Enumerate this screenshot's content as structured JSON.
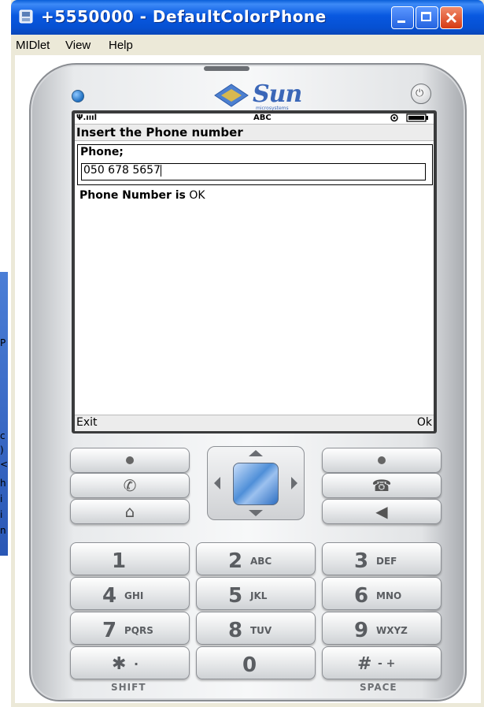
{
  "window": {
    "title": "+5550000 - DefaultColorPhone",
    "colors": {
      "titlebar": "#0858e0",
      "close": "#d63a13"
    }
  },
  "menu": [
    "MIDlet",
    "View",
    "Help"
  ],
  "background_fragments": [
    "P",
    "c",
    ")",
    "<",
    "h",
    "i",
    "i",
    "n"
  ],
  "phone": {
    "logo": "Sun",
    "logo_sub": "microsystems",
    "status": {
      "signal": "Ψ.ıııl",
      "mode": "ABC"
    },
    "screen_title": "Insert the Phone number",
    "field_label": "Phone;",
    "field_value": "050 678 5657",
    "result_label": "Phone Number is",
    "result_value": "OK",
    "soft_left": "Exit",
    "soft_right": "Ok",
    "shift_label": "SHIFT",
    "space_label": "SPACE",
    "keys": [
      {
        "num": "1",
        "letters": ""
      },
      {
        "num": "2",
        "letters": "ABC"
      },
      {
        "num": "3",
        "letters": "DEF"
      },
      {
        "num": "4",
        "letters": "GHI"
      },
      {
        "num": "5",
        "letters": "JKL"
      },
      {
        "num": "6",
        "letters": "MNO"
      },
      {
        "num": "7",
        "letters": "PQRS"
      },
      {
        "num": "8",
        "letters": "TUV"
      },
      {
        "num": "9",
        "letters": "WXYZ"
      },
      {
        "num": "✱",
        "letters": "·"
      },
      {
        "num": "0",
        "letters": ""
      },
      {
        "num": "#",
        "letters": "- +"
      }
    ],
    "icons": [
      "call-icon",
      "home-icon",
      "hangup-icon",
      "back-icon",
      "power-icon",
      "led-icon"
    ]
  }
}
